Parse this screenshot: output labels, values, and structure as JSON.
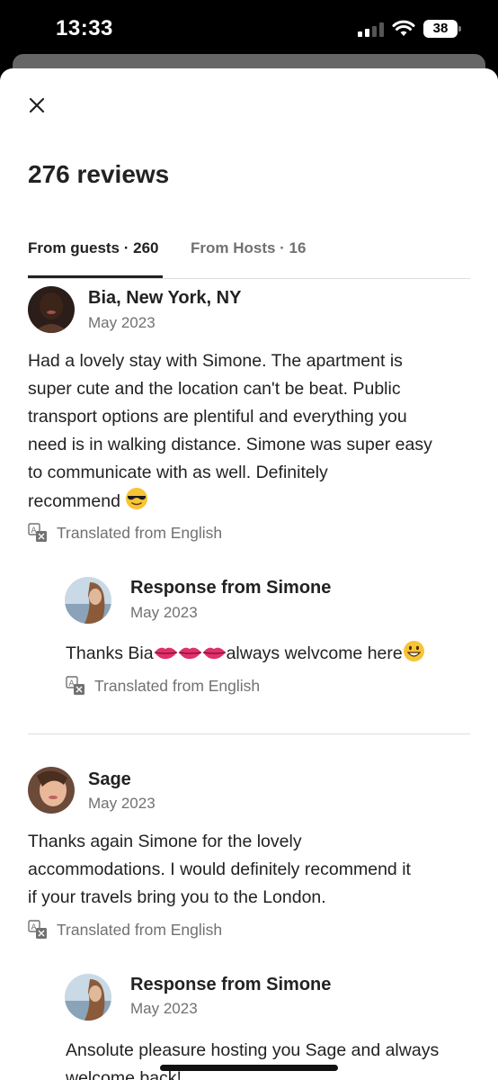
{
  "status_bar": {
    "time": "13:33",
    "battery": "38"
  },
  "header": {
    "title": "276 reviews"
  },
  "tabs": [
    {
      "label": "From guests · 260",
      "selected": true
    },
    {
      "label": "From Hosts · 16",
      "selected": false
    }
  ],
  "reviews": [
    {
      "name": "Bia, New York, NY",
      "date": "May 2023",
      "text_lines": [
        "Had a lovely stay with Simone. The apartment is",
        "super cute and the location can't be beat. Public",
        "transport options are plentiful and everything you",
        "need is in walking distance. Simone was super easy",
        "to communicate with as well. Definitely",
        "recommend"
      ],
      "translated": "Translated from English",
      "response": {
        "title": "Response from Simone",
        "date": "May 2023",
        "text_start": "Thanks Bia",
        "text_end": "always welvcome here",
        "translated": "Translated from English"
      }
    },
    {
      "name": "Sage",
      "date": "May 2023",
      "text_lines": [
        "Thanks again Simone for the lovely",
        "accommodations. I would definitely recommend it",
        "if your travels bring you to the London."
      ],
      "translated": "Translated from English",
      "response": {
        "title": "Response from Simone",
        "date": "May 2023",
        "text_lines": [
          "Ansolute pleasure hosting you Sage and always",
          "welcome back!"
        ]
      }
    }
  ],
  "colors": {
    "primary_text": "#222222",
    "secondary_text": "#717171",
    "divider": "#DDDDDD"
  }
}
